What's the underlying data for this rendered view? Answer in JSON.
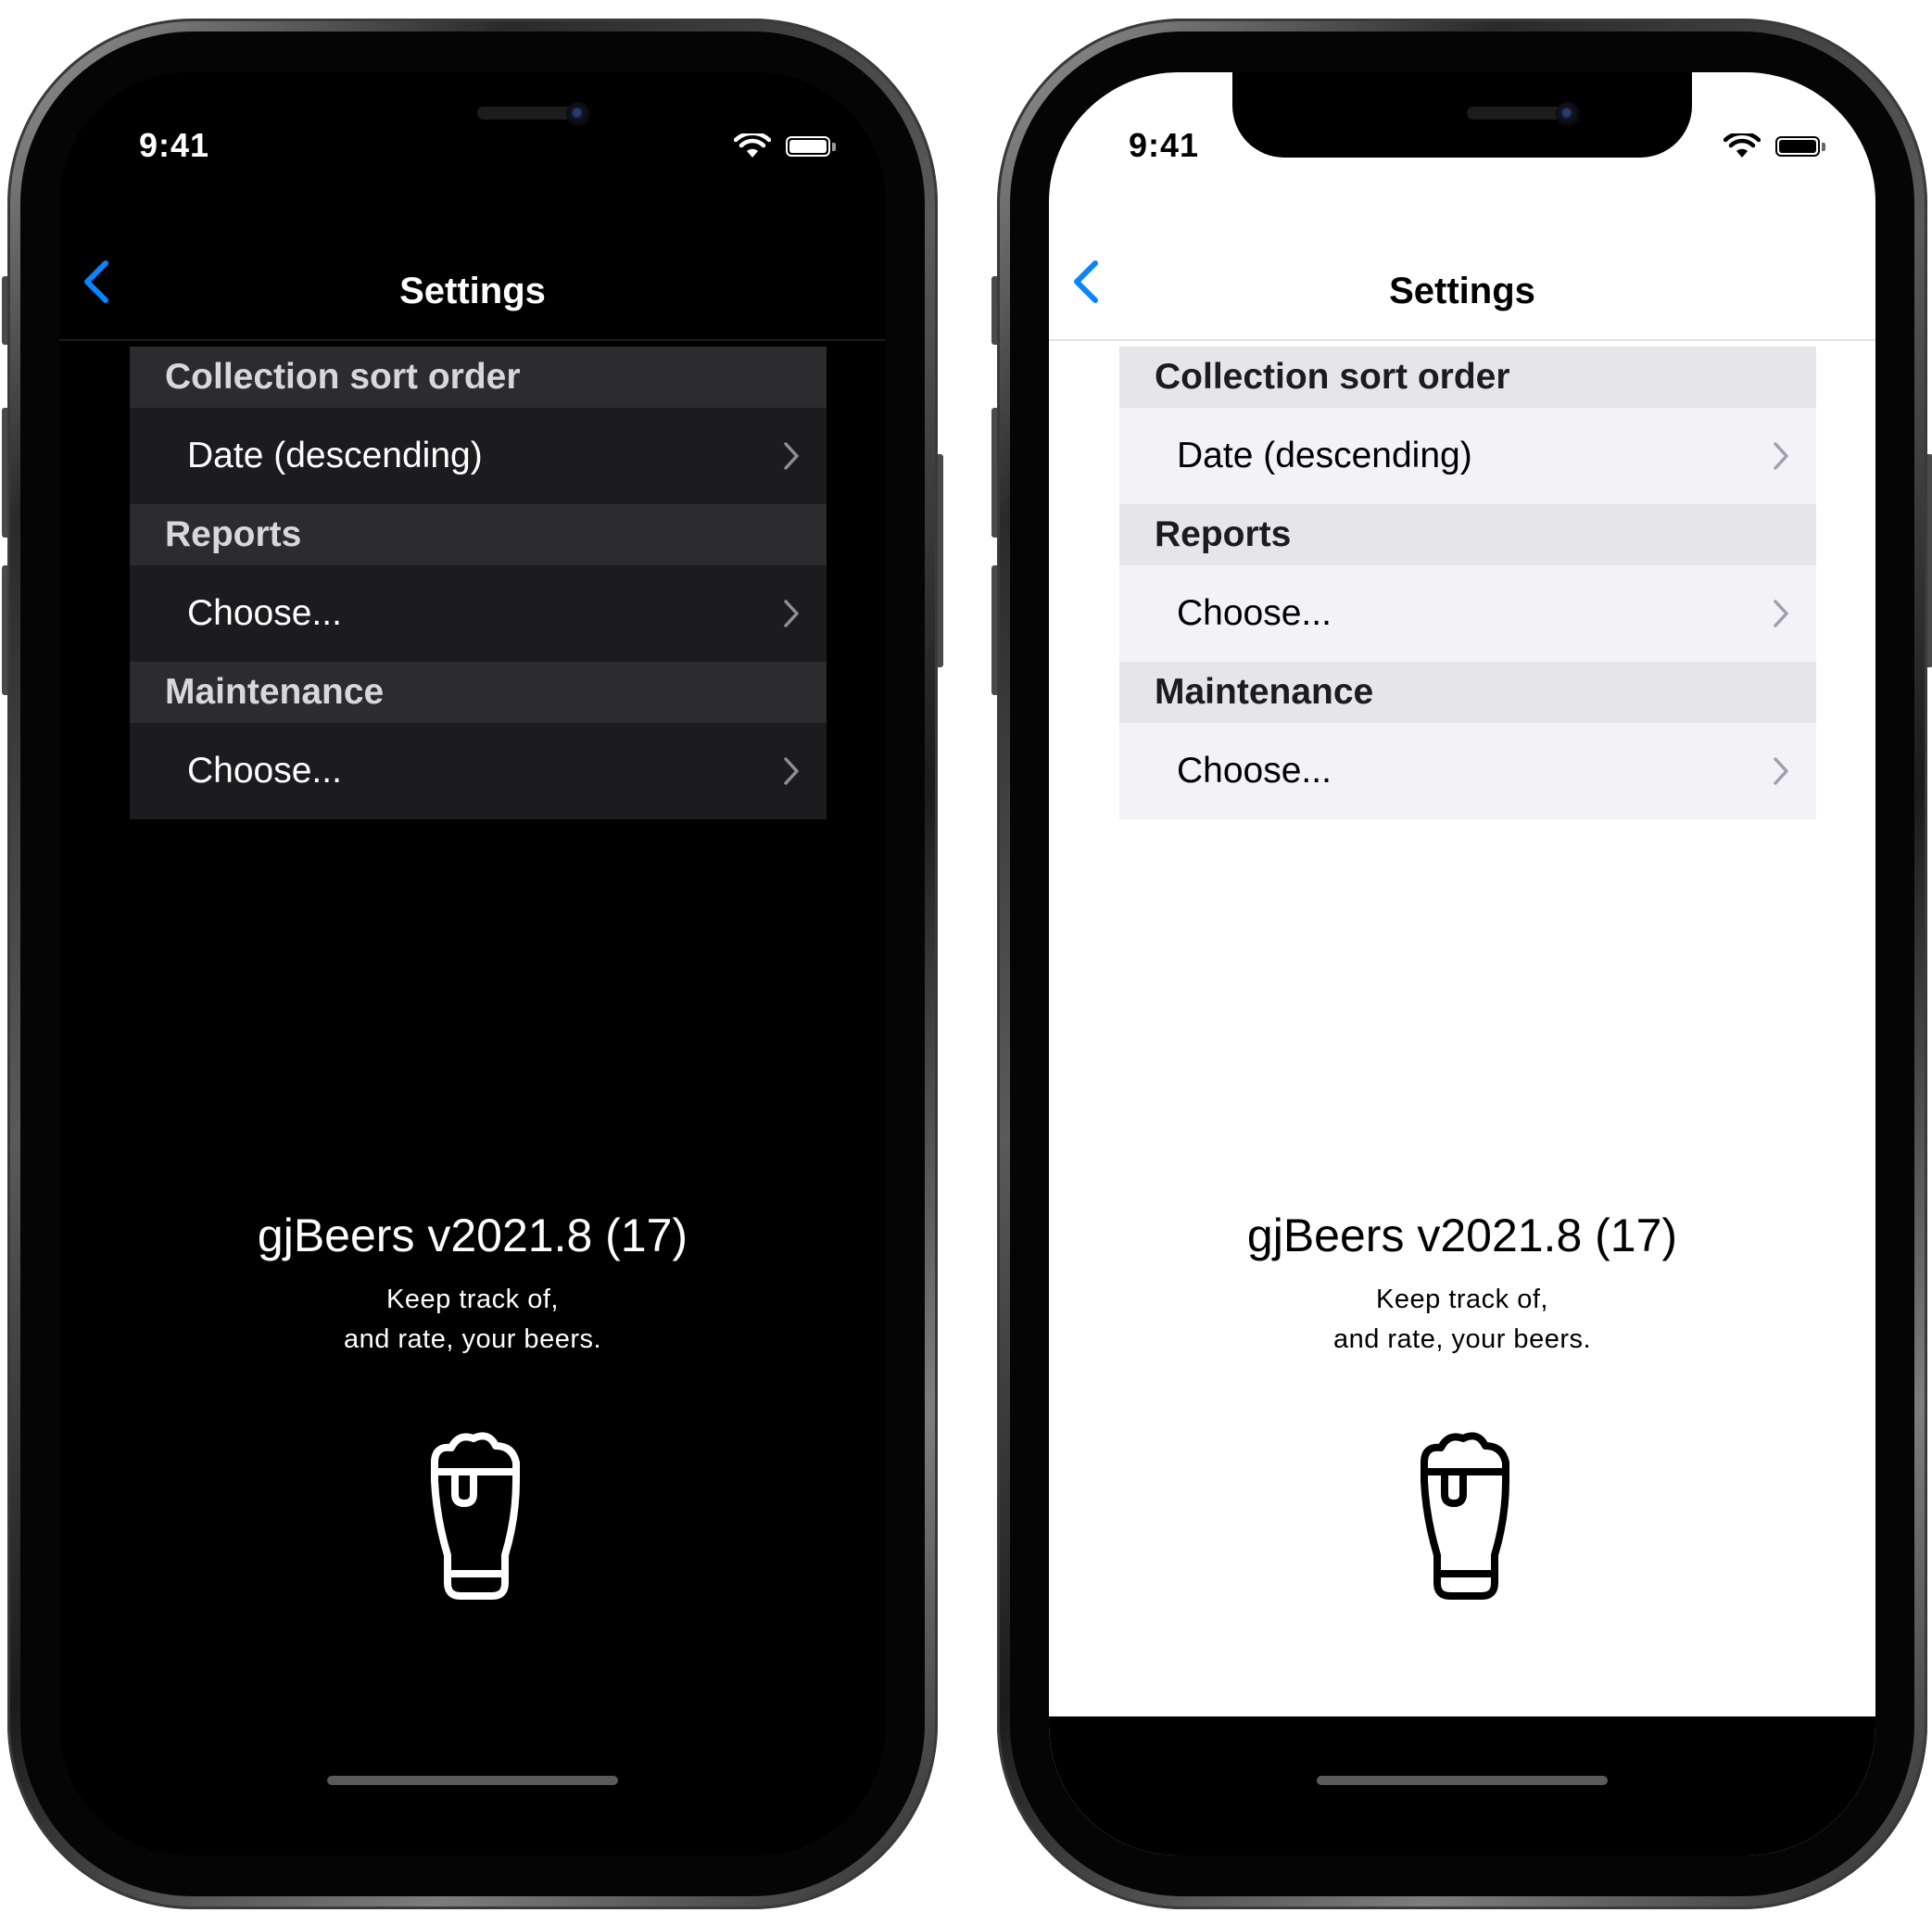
{
  "colors": {
    "accent": "#0a84ff",
    "dark_background": "#000000",
    "light_background": "#ffffff",
    "dark_section_header": "#2c2c2e",
    "dark_row": "#1c1c1e",
    "light_section_header": "#e5e5ea",
    "light_row": "#f2f2f7"
  },
  "screens": [
    {
      "theme": "dark",
      "status_bar": {
        "time": "9:41",
        "icons": [
          "wifi-icon",
          "battery-icon"
        ]
      },
      "nav": {
        "title": "Settings",
        "back_icon": "chevron-left-icon"
      },
      "sections": [
        {
          "header": "Collection sort order",
          "row": "Date (descending)"
        },
        {
          "header": "Reports",
          "row": "Choose..."
        },
        {
          "header": "Maintenance",
          "row": "Choose..."
        }
      ],
      "about": {
        "version": "gjBeers v2021.8 (17)",
        "tagline_line1": "Keep track of,",
        "tagline_line2": "and rate, your beers.",
        "logo_icon": "beer-glass-icon"
      }
    },
    {
      "theme": "light",
      "status_bar": {
        "time": "9:41",
        "icons": [
          "wifi-icon",
          "battery-icon"
        ]
      },
      "nav": {
        "title": "Settings",
        "back_icon": "chevron-left-icon"
      },
      "sections": [
        {
          "header": "Collection sort order",
          "row": "Date (descending)"
        },
        {
          "header": "Reports",
          "row": "Choose..."
        },
        {
          "header": "Maintenance",
          "row": "Choose..."
        }
      ],
      "about": {
        "version": "gjBeers v2021.8 (17)",
        "tagline_line1": "Keep track of,",
        "tagline_line2": "and rate, your beers.",
        "logo_icon": "beer-glass-icon"
      }
    }
  ]
}
